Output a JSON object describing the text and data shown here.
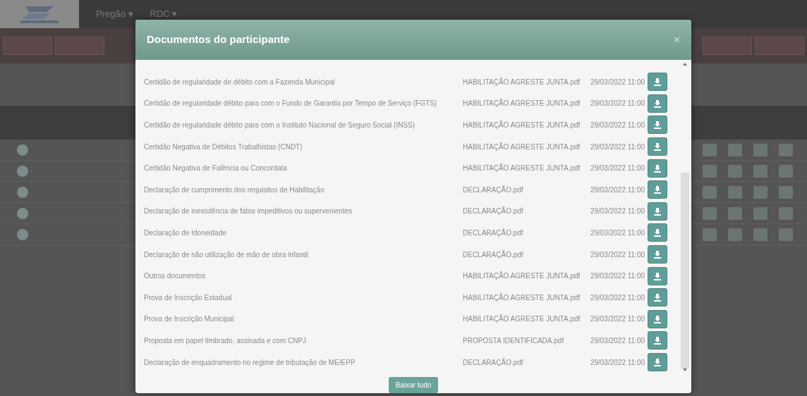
{
  "navbar": {
    "items": [
      {
        "label": "Pregão ▾"
      },
      {
        "label": "RDC ▾"
      }
    ]
  },
  "modal": {
    "title": "Documentos do participante",
    "close": "×",
    "documents": [
      {
        "name": "Certidão de regularidade de débito com a Fazenda Municipal",
        "file": "HABILITAÇÃO AGRESTE JUNTA.pdf",
        "date": "29/03/2022 11:00"
      },
      {
        "name": "Certidão de regularidade débito para com o Fundo de Garantia por Tempo de Serviço (FGTS)",
        "file": "HABILITAÇÃO AGRESTE JUNTA.pdf",
        "date": "29/03/2022 11:00"
      },
      {
        "name": "Certidão de regularidade débito para com o Instituto Nacional de Seguro Social (INSS)",
        "file": "HABILITAÇÃO AGRESTE JUNTA.pdf",
        "date": "29/03/2022 11:00"
      },
      {
        "name": "Certidão Negativa de Débitos Trabalhistas (CNDT)",
        "file": "HABILITAÇÃO AGRESTE JUNTA.pdf",
        "date": "29/03/2022 11:00"
      },
      {
        "name": "Certidão Negativa de Falência ou Concordata",
        "file": "HABILITAÇÃO AGRESTE JUNTA.pdf",
        "date": "29/03/2022 11:00"
      },
      {
        "name": "Declaração de cumprimento dos requisitos de Habilitação",
        "file": "DECLARAÇÃO.pdf",
        "date": "29/03/2022 11:00"
      },
      {
        "name": "Declaração de inexistência de fatos impeditivos ou supervenientes",
        "file": "DECLARAÇÃO.pdf",
        "date": "29/03/2022 11:00"
      },
      {
        "name": "Declaração de Idoneidade",
        "file": "DECLARAÇÃO.pdf",
        "date": "29/03/2022 11:00"
      },
      {
        "name": "Declaração de não utilização de mão de obra infantil",
        "file": "DECLARAÇÃO.pdf",
        "date": "29/03/2022 11:00"
      },
      {
        "name": "Outros documentos",
        "file": "HABILITAÇÃO AGRESTE JUNTA.pdf",
        "date": "29/03/2022 11:00"
      },
      {
        "name": "Prova de Inscrição Estadual",
        "file": "HABILITAÇÃO AGRESTE JUNTA.pdf",
        "date": "29/03/2022 11:00"
      },
      {
        "name": "Prova de Inscrição Municipal",
        "file": "HABILITAÇÃO AGRESTE JUNTA.pdf",
        "date": "29/03/2022 11:00"
      },
      {
        "name": "Proposta em papel timbrado, assinada e com CNPJ",
        "file": "PROPOSTA IDENTIFICADA.pdf",
        "date": "29/03/2022 11:00"
      },
      {
        "name": "Declaração de enquadramento no regime de tributação de ME/EPP",
        "file": "DECLARAÇÃO.pdf",
        "date": "29/03/2022 11:00"
      }
    ],
    "download_all": "Baixar tudo"
  }
}
